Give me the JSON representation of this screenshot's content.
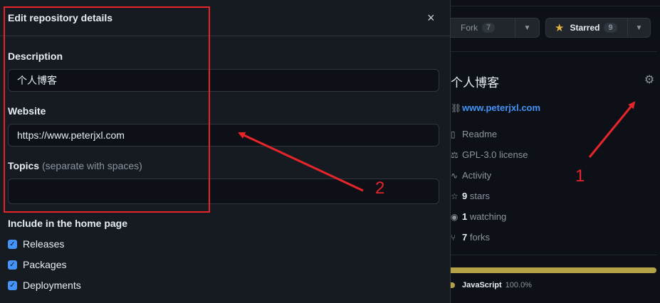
{
  "modal": {
    "title": "Edit repository details",
    "close_glyph": "×",
    "description": {
      "label": "Description",
      "value": "个人博客"
    },
    "website": {
      "label": "Website",
      "value": "https://www.peterjxl.com"
    },
    "topics": {
      "label": "Topics",
      "hint": "(separate with spaces)",
      "value": ""
    },
    "home": {
      "label": "Include in the home page",
      "items": [
        {
          "label": "Releases",
          "checked": true
        },
        {
          "label": "Packages",
          "checked": true
        },
        {
          "label": "Deployments",
          "checked": true
        }
      ]
    }
  },
  "header": {
    "fork": {
      "label": "Fork",
      "count": "7",
      "icon": "fork-icon"
    },
    "star": {
      "label": "Starred",
      "count": "9",
      "icon": "star-icon"
    }
  },
  "about": {
    "description": "个人博客",
    "website": "www.peterjxl.com",
    "items": [
      {
        "icon": "book-icon",
        "text": "Readme"
      },
      {
        "icon": "law-icon",
        "text": "GPL-3.0 license"
      },
      {
        "icon": "pulse-icon",
        "text": "Activity"
      },
      {
        "icon": "star-icon",
        "bold": "9",
        "text": "stars"
      },
      {
        "icon": "eye-icon",
        "bold": "1",
        "text": "watching"
      },
      {
        "icon": "fork-icon",
        "bold": "7",
        "text": "forks"
      }
    ],
    "language": {
      "name": "JavaScript",
      "percent": "100.0%",
      "color": "#b3a246"
    }
  },
  "annotations": {
    "label_1": "1",
    "label_2": "2",
    "color": "#e5252a"
  }
}
